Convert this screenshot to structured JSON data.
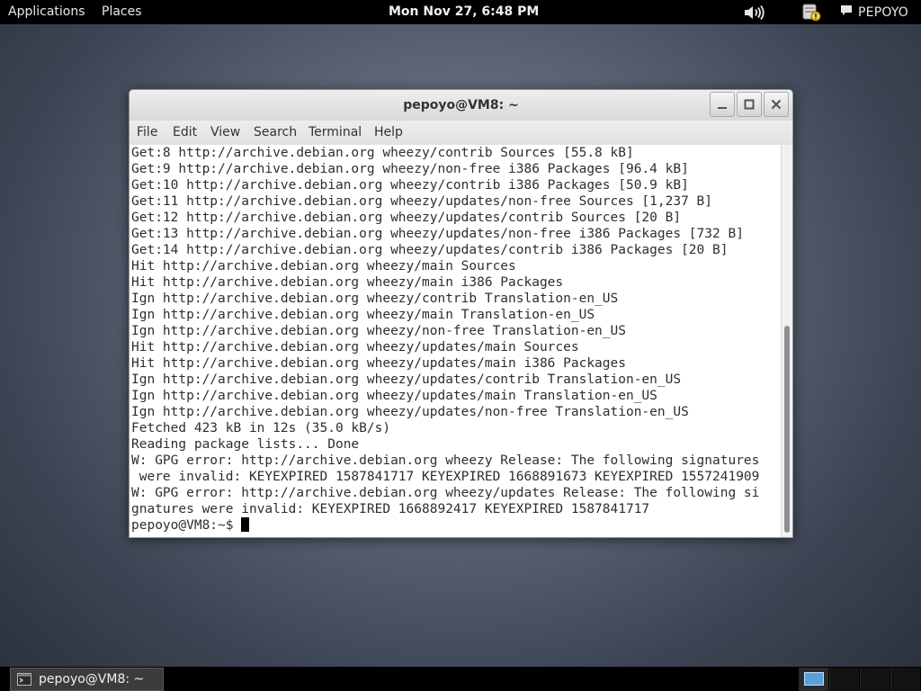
{
  "top_panel": {
    "applications": "Applications",
    "places": "Places",
    "clock": "Mon Nov 27,  6:48 PM",
    "user": "PEPOYO"
  },
  "window": {
    "title": "pepoyo@VM8: ~",
    "menu": [
      "File",
      "Edit",
      "View",
      "Search",
      "Terminal",
      "Help"
    ]
  },
  "terminal": {
    "lines": [
      "Get:8 http://archive.debian.org wheezy/contrib Sources [55.8 kB]",
      "Get:9 http://archive.debian.org wheezy/non-free i386 Packages [96.4 kB]",
      "Get:10 http://archive.debian.org wheezy/contrib i386 Packages [50.9 kB]",
      "Get:11 http://archive.debian.org wheezy/updates/non-free Sources [1,237 B]",
      "Get:12 http://archive.debian.org wheezy/updates/contrib Sources [20 B]",
      "Get:13 http://archive.debian.org wheezy/updates/non-free i386 Packages [732 B]",
      "Get:14 http://archive.debian.org wheezy/updates/contrib i386 Packages [20 B]",
      "Hit http://archive.debian.org wheezy/main Sources",
      "Hit http://archive.debian.org wheezy/main i386 Packages",
      "Ign http://archive.debian.org wheezy/contrib Translation-en_US",
      "Ign http://archive.debian.org wheezy/main Translation-en_US",
      "Ign http://archive.debian.org wheezy/non-free Translation-en_US",
      "Hit http://archive.debian.org wheezy/updates/main Sources",
      "Hit http://archive.debian.org wheezy/updates/main i386 Packages",
      "Ign http://archive.debian.org wheezy/updates/contrib Translation-en_US",
      "Ign http://archive.debian.org wheezy/updates/main Translation-en_US",
      "Ign http://archive.debian.org wheezy/updates/non-free Translation-en_US",
      "Fetched 423 kB in 12s (35.0 kB/s)",
      "Reading package lists... Done",
      "W: GPG error: http://archive.debian.org wheezy Release: The following signatures",
      " were invalid: KEYEXPIRED 1587841717 KEYEXPIRED 1668891673 KEYEXPIRED 1557241909",
      "W: GPG error: http://archive.debian.org wheezy/updates Release: The following si",
      "gnatures were invalid: KEYEXPIRED 1668892417 KEYEXPIRED 1587841717"
    ],
    "prompt": "pepoyo@VM8:~$ "
  },
  "taskbar": {
    "task_label": "pepoyo@VM8: ~"
  },
  "icons": {
    "volume": "volume-icon",
    "notification": "notification-icon",
    "chat": "chat-icon",
    "terminal": "terminal-icon"
  },
  "colors": {
    "panel": "#000000",
    "workspace_active": "#5aa0d8"
  }
}
